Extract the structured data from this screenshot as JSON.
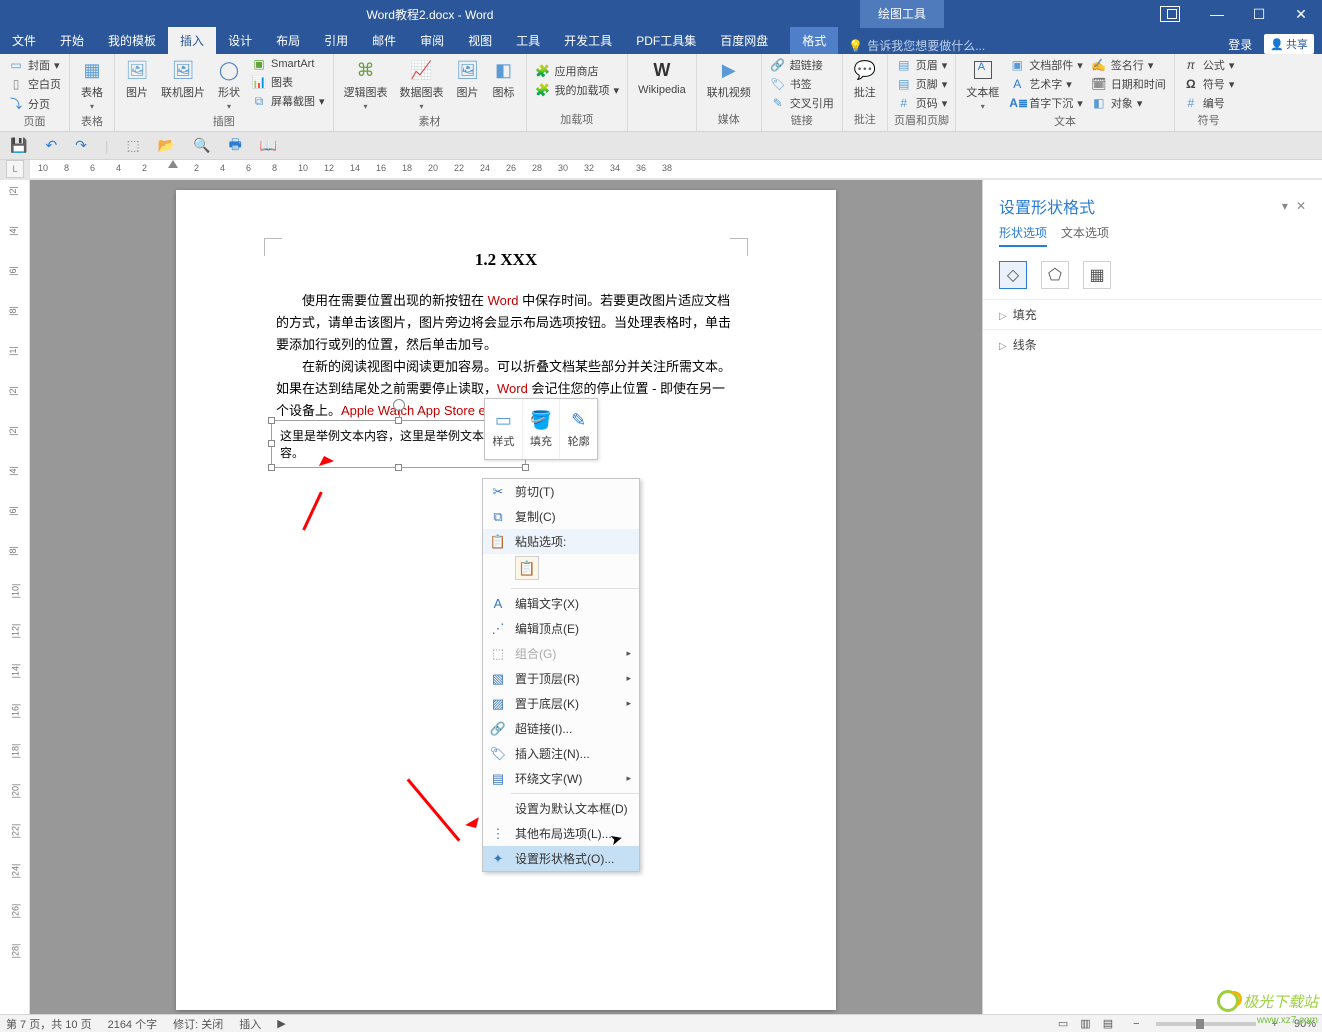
{
  "title": "Word教程2.docx - Word",
  "tool_context_title": "绘图工具",
  "login_label": "登录",
  "share_label": "共享",
  "tabs": [
    "文件",
    "开始",
    "我的模板",
    "插入",
    "设计",
    "布局",
    "引用",
    "邮件",
    "审阅",
    "视图",
    "工具",
    "开发工具",
    "PDF工具集",
    "百度网盘"
  ],
  "active_tab": "插入",
  "context_tab": "格式",
  "tell_me_placeholder": "告诉我您想要做什么...",
  "ribbon": {
    "pages": {
      "label": "页面",
      "cover": "封面",
      "blank": "空白页",
      "break": "分页"
    },
    "tables": {
      "label": "表格",
      "table": "表格"
    },
    "illustrations": {
      "label": "插图",
      "picture": "图片",
      "online_pic": "联机图片",
      "shapes": "形状",
      "smartart": "SmartArt",
      "chart": "图表",
      "screenshot": "屏幕截图"
    },
    "illustrations2": {
      "label": "素材",
      "logic": "逻辑图表",
      "data": "数据图表",
      "pic": "图片",
      "icon": "图标"
    },
    "addins": {
      "label": "加载项",
      "store": "应用商店",
      "myaddins": "我的加载项"
    },
    "media_w": {
      "label": "",
      "wiki": "Wikipedia"
    },
    "media": {
      "label": "媒体",
      "video": "联机视频"
    },
    "links": {
      "label": "链接",
      "hyper": "超链接",
      "bookmark": "书签",
      "crossref": "交叉引用"
    },
    "comments": {
      "label": "批注",
      "comment": "批注"
    },
    "headerfooter": {
      "label": "页眉和页脚",
      "header": "页眉",
      "footer": "页脚",
      "pagenum": "页码"
    },
    "text": {
      "label": "文本",
      "textbox": "文本框",
      "parts": "文档部件",
      "wordart": "艺术字",
      "dropcap": "首字下沉",
      "sigline": "签名行",
      "datetime": "日期和时间",
      "object": "对象"
    },
    "symbols": {
      "label": "符号",
      "equation": "公式",
      "symbol": "符号",
      "number": "编号"
    }
  },
  "document": {
    "heading": "1.2 XXX",
    "para1_a": "使用在需要位置出现的新按钮在 ",
    "para1_word": "Word",
    "para1_b": " 中保存时间。若要更改图片适应文档的方式，请单击该图片，图片旁边将会显示布局选项按钮。当处理表格时，单击要添加行或列的位置，然后单击加号。",
    "para2_a": "在新的阅读视图中阅读更加容易。可以折叠文档某些部分并关注所需文本。如果在达到结尾处之前需要停止读取，",
    "para2_word": "Word",
    "para2_b": " 会记住您的停止位置 - 即使在另一个设备上。",
    "red_links": "Apple Watch   App Store             example",
    "textbox_content": "这里是举例文本内容，这里是举例文本内容。"
  },
  "mini_toolbar": {
    "style": "样式",
    "fill": "填充",
    "outline": "轮廓"
  },
  "context_menu": {
    "cut": "剪切(T)",
    "copy": "复制(C)",
    "paste_options": "粘贴选项:",
    "edit_text": "编辑文字(X)",
    "edit_points": "编辑顶点(E)",
    "group": "组合(G)",
    "bring_front": "置于顶层(R)",
    "send_back": "置于底层(K)",
    "hyperlink": "超链接(I)...",
    "caption": "插入题注(N)...",
    "wrap_text": "环绕文字(W)",
    "default_textbox": "设置为默认文本框(D)",
    "more_layout": "其他布局选项(L)...",
    "format_shape": "设置形状格式(O)..."
  },
  "side_pane": {
    "title": "设置形状格式",
    "tab_shape": "形状选项",
    "tab_text": "文本选项",
    "acc_fill": "填充",
    "acc_line": "线条"
  },
  "ruler_nums": [
    "10",
    "8",
    "6",
    "4",
    "2",
    "",
    "2",
    "4",
    "6",
    "8",
    "10",
    "12",
    "14",
    "16",
    "18",
    "20",
    "22",
    "24",
    "26",
    "28",
    "30",
    "32",
    "34",
    "36",
    "38"
  ],
  "vruler_nums": [
    "|2|",
    "|4|",
    "|6|",
    "|8|",
    "|1|",
    "|2|",
    "|2|",
    "|4|",
    "|6|",
    "|8|",
    "|10|",
    "|12|",
    "|14|",
    "|16|",
    "|18|",
    "|20|",
    "|22|",
    "|24|",
    "|26|",
    "|28|"
  ],
  "status": {
    "page": "第 7 页，共 10 页",
    "words": "2164 个字",
    "track": "修订: 关闭",
    "insert": "插入",
    "zoom_pct": "90%"
  },
  "watermark": {
    "text": "极光下载站",
    "url": "www.xz7.com"
  }
}
